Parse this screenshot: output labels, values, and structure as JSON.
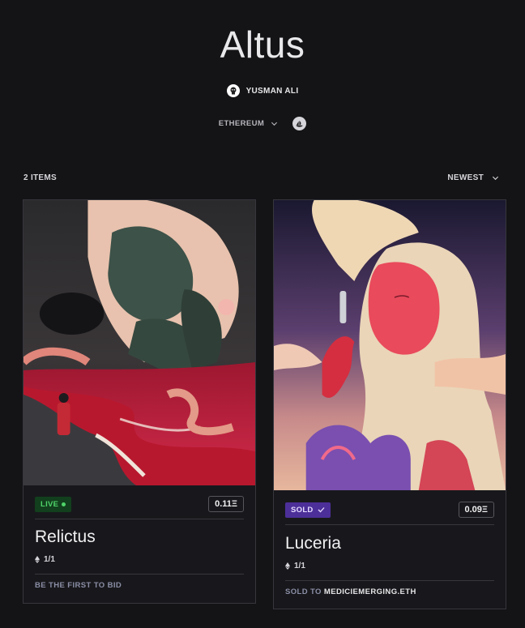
{
  "collection": {
    "title": "Altus",
    "creator": "YUSMAN ALI",
    "network": "ETHEREUM"
  },
  "listing": {
    "items_count": "2 ITEMS",
    "sort_label": "NEWEST"
  },
  "cards": [
    {
      "title": "Relictus",
      "status": "LIVE",
      "price": "0.11Ξ",
      "edition": "1/1",
      "footer": "BE THE FIRST TO BID"
    },
    {
      "title": "Luceria",
      "status": "SOLD",
      "price": "0.09Ξ",
      "edition": "1/1",
      "footer_prefix": "SOLD TO",
      "footer_owner": "MEDICIEMERGING.ETH"
    }
  ],
  "colors": {
    "background": "#141417",
    "live_green": "#4fd46a",
    "sold_purple": "#4d2f99"
  },
  "icons": [
    "creator-avatar-icon",
    "chevron-down-icon",
    "opensea-icon",
    "ethereum-icon",
    "check-icon"
  ]
}
